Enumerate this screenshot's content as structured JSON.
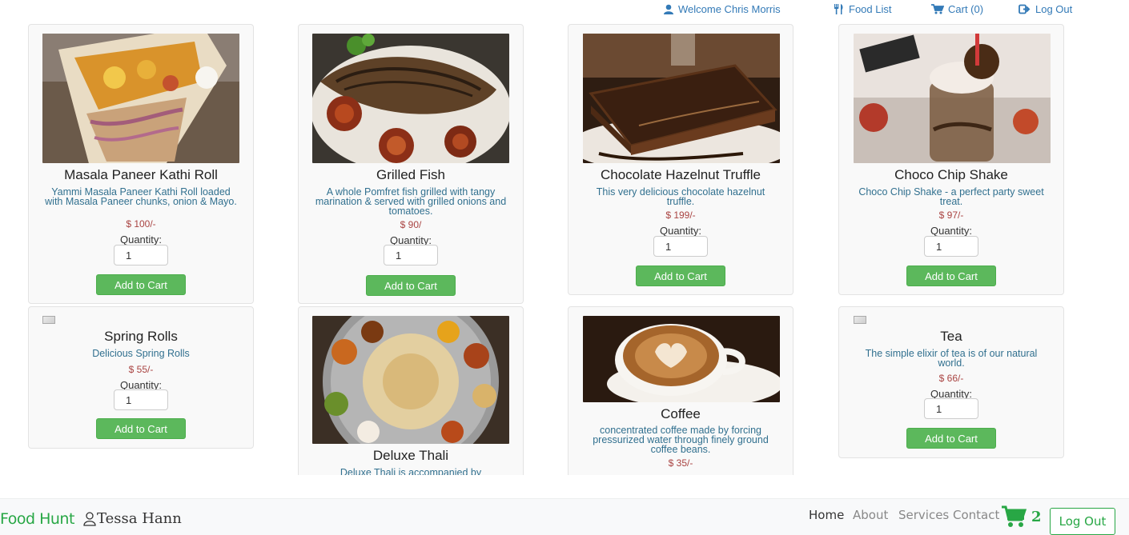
{
  "topnav": {
    "welcome": "Welcome Chris Morris",
    "food_list": "Food List",
    "cart": "Cart (0)",
    "logout": "Log Out",
    "link_color": "#337ab7"
  },
  "products": [
    {
      "name": "Masala Paneer Kathi Roll",
      "description": "Yammi Masala Paneer Kathi Roll loaded with Masala Paneer chunks, onion & Mayo.",
      "price": "$ 100/-",
      "quantity_label": "Quantity:",
      "quantity": "1",
      "button": "Add to Cart",
      "image": "kathi-roll-photo"
    },
    {
      "name": "Grilled Fish",
      "description": "A whole Pomfret fish grilled with tangy marination & served with grilled onions and tomatoes.",
      "price": "$ 90/",
      "quantity_label": "Quantity:",
      "quantity": "1",
      "button": "Add to Cart",
      "image": "grilled-fish-photo"
    },
    {
      "name": "Chocolate Hazelnut Truffle",
      "description": "This very delicious chocolate hazelnut truffle.",
      "price": "$ 199/-",
      "quantity_label": "Quantity:",
      "quantity": "1",
      "button": "Add to Cart",
      "image": "chocolate-cake-photo"
    },
    {
      "name": "Choco Chip Shake",
      "description": "Choco Chip Shake - a perfect party sweet treat.",
      "price": "$ 97/-",
      "quantity_label": "Quantity:",
      "quantity": "1",
      "button": "Add to Cart",
      "image": "choco-shake-photo"
    },
    {
      "name": "Spring Rolls",
      "description": "Delicious Spring Rolls",
      "price": "$ 55/-",
      "quantity_label": "Quantity:",
      "quantity": "1",
      "button": "Add to Cart",
      "image": "broken-image"
    },
    {
      "name": "Deluxe Thali",
      "description": "Deluxe Thali is accompanied by",
      "image": "thali-photo"
    },
    {
      "name": "Coffee",
      "description": "concentrated coffee made by forcing pressurized water through finely ground coffee beans.",
      "price": "$ 35/-",
      "image": "coffee-photo"
    },
    {
      "name": "Tea",
      "description": "The simple elixir of tea is of our natural world.",
      "price": "$ 66/-",
      "quantity_label": "Quantity:",
      "quantity": "1",
      "button": "Add to Cart",
      "image": "broken-image"
    }
  ],
  "colors": {
    "add_button": "#5cb85c",
    "price": "#a94442",
    "description": "#31708f",
    "brand": "#28a745"
  },
  "bottomnav": {
    "brand": "Food Hunt",
    "user": "Tessa Hann",
    "links": [
      "Home",
      "About",
      "Services",
      "Contact"
    ],
    "active": "Home",
    "cart_count": "2",
    "logout": "Log Out"
  }
}
